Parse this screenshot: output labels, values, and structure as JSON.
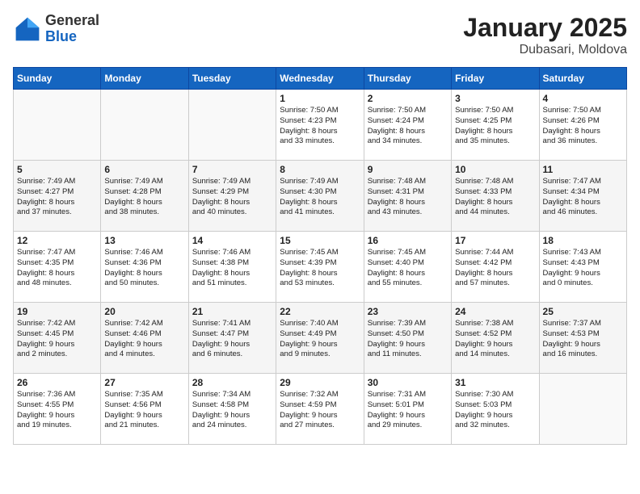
{
  "header": {
    "logo_general": "General",
    "logo_blue": "Blue",
    "month_title": "January 2025",
    "location": "Dubasari, Moldova"
  },
  "days_of_week": [
    "Sunday",
    "Monday",
    "Tuesday",
    "Wednesday",
    "Thursday",
    "Friday",
    "Saturday"
  ],
  "weeks": [
    [
      {
        "day": "",
        "info": ""
      },
      {
        "day": "",
        "info": ""
      },
      {
        "day": "",
        "info": ""
      },
      {
        "day": "1",
        "info": "Sunrise: 7:50 AM\nSunset: 4:23 PM\nDaylight: 8 hours\nand 33 minutes."
      },
      {
        "day": "2",
        "info": "Sunrise: 7:50 AM\nSunset: 4:24 PM\nDaylight: 8 hours\nand 34 minutes."
      },
      {
        "day": "3",
        "info": "Sunrise: 7:50 AM\nSunset: 4:25 PM\nDaylight: 8 hours\nand 35 minutes."
      },
      {
        "day": "4",
        "info": "Sunrise: 7:50 AM\nSunset: 4:26 PM\nDaylight: 8 hours\nand 36 minutes."
      }
    ],
    [
      {
        "day": "5",
        "info": "Sunrise: 7:49 AM\nSunset: 4:27 PM\nDaylight: 8 hours\nand 37 minutes."
      },
      {
        "day": "6",
        "info": "Sunrise: 7:49 AM\nSunset: 4:28 PM\nDaylight: 8 hours\nand 38 minutes."
      },
      {
        "day": "7",
        "info": "Sunrise: 7:49 AM\nSunset: 4:29 PM\nDaylight: 8 hours\nand 40 minutes."
      },
      {
        "day": "8",
        "info": "Sunrise: 7:49 AM\nSunset: 4:30 PM\nDaylight: 8 hours\nand 41 minutes."
      },
      {
        "day": "9",
        "info": "Sunrise: 7:48 AM\nSunset: 4:31 PM\nDaylight: 8 hours\nand 43 minutes."
      },
      {
        "day": "10",
        "info": "Sunrise: 7:48 AM\nSunset: 4:33 PM\nDaylight: 8 hours\nand 44 minutes."
      },
      {
        "day": "11",
        "info": "Sunrise: 7:47 AM\nSunset: 4:34 PM\nDaylight: 8 hours\nand 46 minutes."
      }
    ],
    [
      {
        "day": "12",
        "info": "Sunrise: 7:47 AM\nSunset: 4:35 PM\nDaylight: 8 hours\nand 48 minutes."
      },
      {
        "day": "13",
        "info": "Sunrise: 7:46 AM\nSunset: 4:36 PM\nDaylight: 8 hours\nand 50 minutes."
      },
      {
        "day": "14",
        "info": "Sunrise: 7:46 AM\nSunset: 4:38 PM\nDaylight: 8 hours\nand 51 minutes."
      },
      {
        "day": "15",
        "info": "Sunrise: 7:45 AM\nSunset: 4:39 PM\nDaylight: 8 hours\nand 53 minutes."
      },
      {
        "day": "16",
        "info": "Sunrise: 7:45 AM\nSunset: 4:40 PM\nDaylight: 8 hours\nand 55 minutes."
      },
      {
        "day": "17",
        "info": "Sunrise: 7:44 AM\nSunset: 4:42 PM\nDaylight: 8 hours\nand 57 minutes."
      },
      {
        "day": "18",
        "info": "Sunrise: 7:43 AM\nSunset: 4:43 PM\nDaylight: 9 hours\nand 0 minutes."
      }
    ],
    [
      {
        "day": "19",
        "info": "Sunrise: 7:42 AM\nSunset: 4:45 PM\nDaylight: 9 hours\nand 2 minutes."
      },
      {
        "day": "20",
        "info": "Sunrise: 7:42 AM\nSunset: 4:46 PM\nDaylight: 9 hours\nand 4 minutes."
      },
      {
        "day": "21",
        "info": "Sunrise: 7:41 AM\nSunset: 4:47 PM\nDaylight: 9 hours\nand 6 minutes."
      },
      {
        "day": "22",
        "info": "Sunrise: 7:40 AM\nSunset: 4:49 PM\nDaylight: 9 hours\nand 9 minutes."
      },
      {
        "day": "23",
        "info": "Sunrise: 7:39 AM\nSunset: 4:50 PM\nDaylight: 9 hours\nand 11 minutes."
      },
      {
        "day": "24",
        "info": "Sunrise: 7:38 AM\nSunset: 4:52 PM\nDaylight: 9 hours\nand 14 minutes."
      },
      {
        "day": "25",
        "info": "Sunrise: 7:37 AM\nSunset: 4:53 PM\nDaylight: 9 hours\nand 16 minutes."
      }
    ],
    [
      {
        "day": "26",
        "info": "Sunrise: 7:36 AM\nSunset: 4:55 PM\nDaylight: 9 hours\nand 19 minutes."
      },
      {
        "day": "27",
        "info": "Sunrise: 7:35 AM\nSunset: 4:56 PM\nDaylight: 9 hours\nand 21 minutes."
      },
      {
        "day": "28",
        "info": "Sunrise: 7:34 AM\nSunset: 4:58 PM\nDaylight: 9 hours\nand 24 minutes."
      },
      {
        "day": "29",
        "info": "Sunrise: 7:32 AM\nSunset: 4:59 PM\nDaylight: 9 hours\nand 27 minutes."
      },
      {
        "day": "30",
        "info": "Sunrise: 7:31 AM\nSunset: 5:01 PM\nDaylight: 9 hours\nand 29 minutes."
      },
      {
        "day": "31",
        "info": "Sunrise: 7:30 AM\nSunset: 5:03 PM\nDaylight: 9 hours\nand 32 minutes."
      },
      {
        "day": "",
        "info": ""
      }
    ]
  ]
}
